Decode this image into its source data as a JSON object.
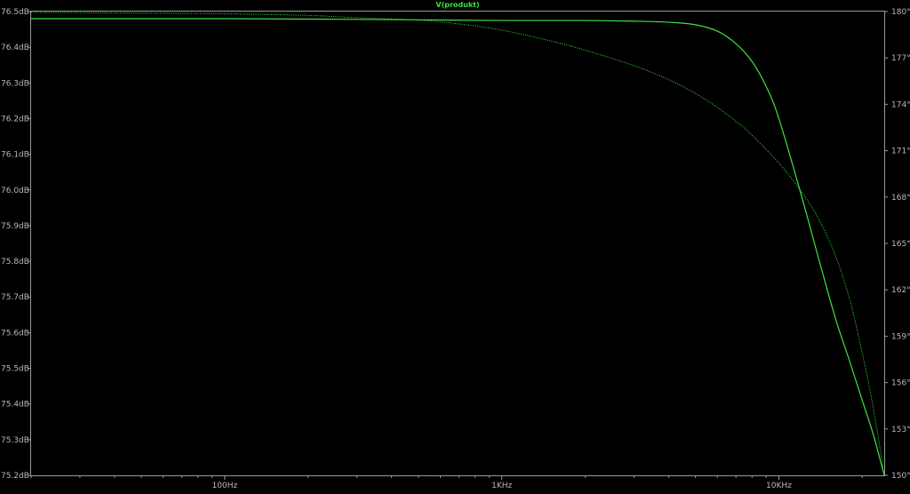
{
  "chart_data": {
    "type": "line",
    "title": "V(produkt)",
    "x_scale": "log",
    "x_ticks": [
      {
        "value": 100,
        "label": "100Hz"
      },
      {
        "value": 1000,
        "label": "1KHz"
      },
      {
        "value": 10000,
        "label": "10KHz"
      }
    ],
    "x_minor_ticks": [
      20,
      30,
      40,
      50,
      60,
      70,
      80,
      90,
      200,
      300,
      400,
      500,
      600,
      700,
      800,
      900,
      2000,
      3000,
      4000,
      5000,
      6000,
      7000,
      8000,
      9000,
      20000
    ],
    "xlim": [
      20,
      24000
    ],
    "y_left": {
      "unit": "dB",
      "ylim": [
        75.2,
        76.5
      ],
      "ticks": [
        {
          "value": 76.5,
          "label": "76.5dB"
        },
        {
          "value": 76.4,
          "label": "76.4dB"
        },
        {
          "value": 76.3,
          "label": "76.3dB"
        },
        {
          "value": 76.2,
          "label": "76.2dB"
        },
        {
          "value": 76.1,
          "label": "76.1dB"
        },
        {
          "value": 76.0,
          "label": "76.0dB"
        },
        {
          "value": 75.9,
          "label": "75.9dB"
        },
        {
          "value": 75.8,
          "label": "75.8dB"
        },
        {
          "value": 75.7,
          "label": "75.7dB"
        },
        {
          "value": 75.6,
          "label": "75.6dB"
        },
        {
          "value": 75.5,
          "label": "75.5dB"
        },
        {
          "value": 75.4,
          "label": "75.4dB"
        },
        {
          "value": 75.3,
          "label": "75.3dB"
        },
        {
          "value": 75.2,
          "label": "75.2dB"
        }
      ]
    },
    "y_right": {
      "unit": "°",
      "ylim": [
        150,
        180
      ],
      "ticks": [
        {
          "value": 180,
          "label": "180°"
        },
        {
          "value": 177,
          "label": "177°"
        },
        {
          "value": 174,
          "label": "174°"
        },
        {
          "value": 171,
          "label": "171°"
        },
        {
          "value": 168,
          "label": "168°"
        },
        {
          "value": 165,
          "label": "165°"
        },
        {
          "value": 162,
          "label": "162°"
        },
        {
          "value": 159,
          "label": "159°"
        },
        {
          "value": 156,
          "label": "156°"
        },
        {
          "value": 153,
          "label": "153°"
        },
        {
          "value": 150,
          "label": "150°"
        }
      ]
    },
    "series": [
      {
        "axis": "left",
        "style": "solid",
        "color": "#3ee23e",
        "x": [
          20,
          50,
          100,
          300,
          1000,
          2000,
          3000,
          4000,
          5000,
          6000,
          7000,
          8000,
          9000,
          10000,
          12000,
          14000,
          16000,
          18000,
          20000,
          22000,
          24000
        ],
        "y": [
          76.48,
          76.48,
          76.48,
          76.478,
          76.475,
          76.475,
          76.473,
          76.47,
          76.463,
          76.445,
          76.41,
          76.36,
          76.29,
          76.2,
          75.99,
          75.8,
          75.64,
          75.52,
          75.41,
          75.31,
          75.2
        ]
      },
      {
        "axis": "right",
        "style": "dotted",
        "color": "#3ee23e",
        "x": [
          20,
          50,
          100,
          200,
          300,
          500,
          700,
          1000,
          1500,
          2000,
          3000,
          4000,
          5000,
          6000,
          7000,
          8000,
          10000,
          12000,
          14000,
          16000,
          18000,
          20000,
          22000,
          24000
        ],
        "y": [
          179.95,
          179.9,
          179.85,
          179.75,
          179.6,
          179.45,
          179.2,
          178.8,
          178.1,
          177.5,
          176.5,
          175.6,
          174.7,
          173.8,
          172.9,
          172.0,
          170.2,
          168.4,
          166.5,
          164.2,
          161.4,
          157.9,
          154.2,
          150.0
        ]
      }
    ]
  },
  "colors": {
    "background": "#000000",
    "trace": "#3ee23e",
    "axis": "#9a9a9a",
    "text": "#b8b8b8"
  }
}
